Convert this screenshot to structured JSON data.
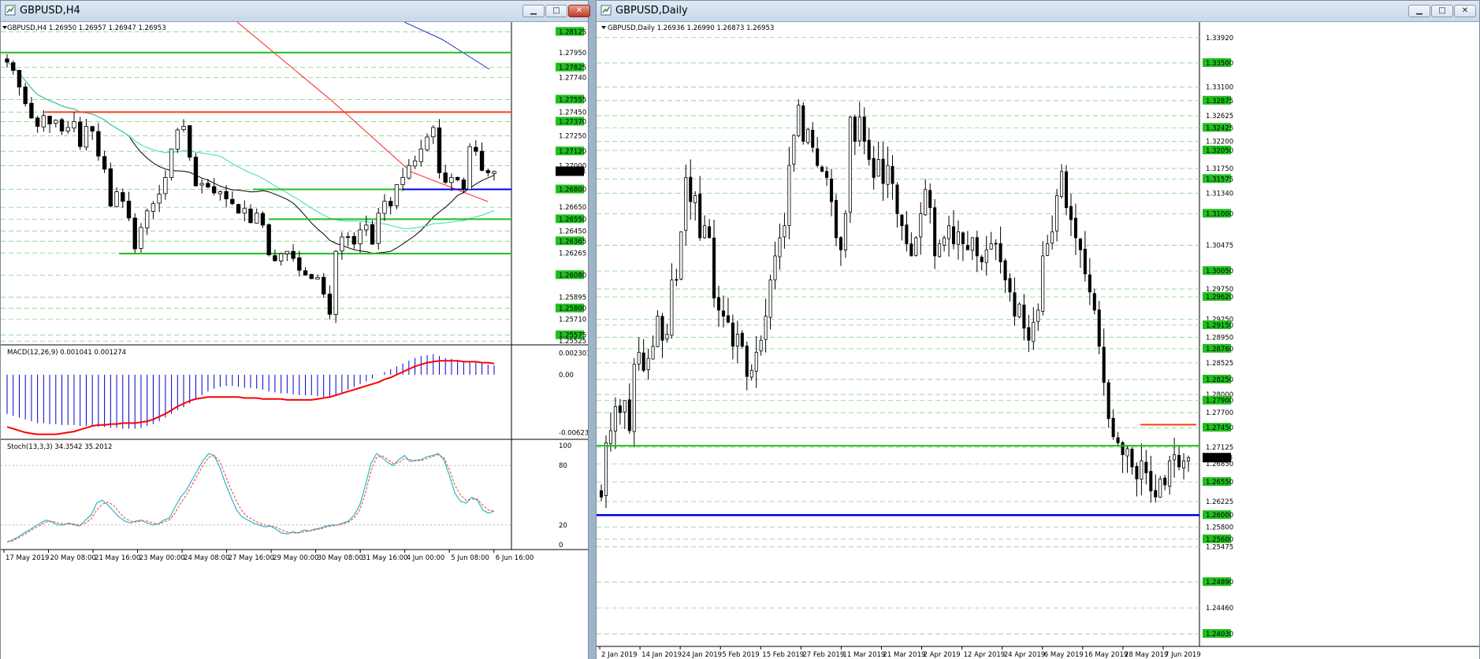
{
  "windows": {
    "left": {
      "title": "GBPUSD,H4",
      "buttons": {
        "minimize": "▁",
        "maximize": "□",
        "close": "✕"
      },
      "chart_header": "GBPUSD,H4  1.26950 1.26957 1.26947 1.26953",
      "macd_header": "MACD(12,26,9) 0.001041 0.001274",
      "stoch_header": "Stoch(13,3,3) 34.3542 35.2012"
    },
    "right": {
      "title": "GBPUSD,Daily",
      "buttons": {
        "minimize": "▁",
        "maximize": "□",
        "close": "✕"
      },
      "chart_header": "GBPUSD,Daily  1.26936 1.26990 1.26873 1.26953"
    }
  },
  "colors": {
    "green_level": "#1fbf1f",
    "dashed_level": "#7fd67f",
    "red_level": "#ff3c1a",
    "blue_level": "#0000dd",
    "price_badge": "#000000",
    "macd_hist": "#0000cc",
    "macd_signal": "#ff0000",
    "stoch_main": "#2ab7c9",
    "stoch_signal": "#ff3333",
    "ma_black": "#000000",
    "ma_red": "#ff2020",
    "ma_cyan": "#33e0b0",
    "ma_blue": "#2233cc"
  },
  "chart_data": [
    {
      "id": "h4_price",
      "type": "candlestick",
      "symbol": "GBPUSD",
      "timeframe": "H4",
      "last_price": "1.26953",
      "y_range": [
        1.2552,
        1.2818
      ],
      "y_ticks": [
        "1.28125",
        "1.27950",
        "1.27825",
        "1.27740",
        "1.27555",
        "1.27450",
        "1.27370",
        "1.27250",
        "1.27120",
        "1.27000",
        "1.26800",
        "1.26650",
        "1.26550",
        "1.26450",
        "1.26365",
        "1.26265",
        "1.26080",
        "1.25895",
        "1.25800",
        "1.25710",
        "1.25575",
        "1.25525"
      ],
      "x_labels": [
        "17 May 2019",
        "20 May 08:00",
        "21 May 16:00",
        "23 May 00:00",
        "24 May 08:00",
        "27 May 16:00",
        "29 May 00:00",
        "30 May 08:00",
        "31 May 16:00",
        "4 Jun 00:00",
        "5 Jun 08:00",
        "6 Jun 16:00"
      ],
      "green_levels": [
        1.2795,
        1.268,
        1.2655,
        1.2626
      ],
      "red_level": 1.2745,
      "blue_level": 1.268,
      "closes": [
        1.2787,
        1.278,
        1.2766,
        1.2752,
        1.274,
        1.2733,
        1.2742,
        1.2735,
        1.2738,
        1.2729,
        1.2732,
        1.2737,
        1.2716,
        1.2733,
        1.2729,
        1.2708,
        1.2697,
        1.2666,
        1.2678,
        1.267,
        1.2656,
        1.263,
        1.2648,
        1.2662,
        1.2668,
        1.2676,
        1.269,
        1.2714,
        1.273,
        1.2733,
        1.2707,
        1.2683,
        1.2685,
        1.2682,
        1.2677,
        1.2678,
        1.2672,
        1.2668,
        1.266,
        1.2664,
        1.2652,
        1.266,
        1.265,
        1.2625,
        1.262,
        1.2626,
        1.2628,
        1.2622,
        1.2612,
        1.2608,
        1.2605,
        1.2606,
        1.2592,
        1.2575,
        1.2628,
        1.264,
        1.264,
        1.2634,
        1.2646,
        1.265,
        1.2634,
        1.266,
        1.267,
        1.2666,
        1.2684,
        1.269,
        1.27,
        1.2704,
        1.2714,
        1.2724,
        1.2732,
        1.2694,
        1.2686,
        1.269,
        1.2688,
        1.268,
        1.2716,
        1.2712,
        1.2696,
        1.2694,
        1.2695
      ]
    },
    {
      "id": "h4_macd",
      "type": "histogram+line",
      "name": "MACD(12,26,9)",
      "y_ticks": [
        "0.002301",
        "0.00",
        "-0.006231"
      ],
      "y_range": [
        -0.0066,
        0.0027
      ],
      "histogram": [
        -0.0042,
        -0.0044,
        -0.0046,
        -0.0048,
        -0.005,
        -0.0052,
        -0.0052,
        -0.0053,
        -0.0053,
        -0.0054,
        -0.0054,
        -0.0054,
        -0.0055,
        -0.0055,
        -0.0055,
        -0.0056,
        -0.0056,
        -0.0057,
        -0.0057,
        -0.0058,
        -0.0058,
        -0.0058,
        -0.0057,
        -0.0055,
        -0.0053,
        -0.005,
        -0.0046,
        -0.0042,
        -0.0038,
        -0.0035,
        -0.0031,
        -0.0026,
        -0.0022,
        -0.0018,
        -0.0015,
        -0.0013,
        -0.0012,
        -0.0012,
        -0.0013,
        -0.0014,
        -0.0014,
        -0.0015,
        -0.0016,
        -0.0018,
        -0.0019,
        -0.002,
        -0.002,
        -0.0021,
        -0.0022,
        -0.0022,
        -0.0022,
        -0.0023,
        -0.0024,
        -0.0025,
        -0.0022,
        -0.0019,
        -0.0016,
        -0.0013,
        -0.001,
        -0.0007,
        -0.0004,
        0.0,
        0.0003,
        0.0006,
        0.0009,
        0.0012,
        0.0015,
        0.0018,
        0.002,
        0.0021,
        0.0022,
        0.002,
        0.0018,
        0.0017,
        0.0016,
        0.0014,
        0.0014,
        0.0014,
        0.0013,
        0.0011,
        0.001
      ],
      "signal": [
        -0.0056,
        -0.0058,
        -0.006,
        -0.0062,
        -0.0063,
        -0.0064,
        -0.0064,
        -0.0064,
        -0.0064,
        -0.0063,
        -0.0062,
        -0.0061,
        -0.0059,
        -0.0057,
        -0.0055,
        -0.0054,
        -0.0054,
        -0.0053,
        -0.0053,
        -0.0052,
        -0.0052,
        -0.0052,
        -0.0051,
        -0.005,
        -0.0048,
        -0.0045,
        -0.0042,
        -0.0038,
        -0.0034,
        -0.0031,
        -0.0028,
        -0.0026,
        -0.0025,
        -0.0024,
        -0.0024,
        -0.0024,
        -0.0024,
        -0.0024,
        -0.0024,
        -0.0025,
        -0.0025,
        -0.0025,
        -0.0026,
        -0.0026,
        -0.0026,
        -0.0026,
        -0.0027,
        -0.0027,
        -0.0027,
        -0.0027,
        -0.0027,
        -0.0026,
        -0.0025,
        -0.0024,
        -0.0022,
        -0.002,
        -0.0018,
        -0.0016,
        -0.0014,
        -0.0012,
        -0.001,
        -0.0008,
        -0.0005,
        -0.0003,
        0.0,
        0.0003,
        0.0006,
        0.0009,
        0.0011,
        0.0013,
        0.0014,
        0.0015,
        0.0015,
        0.0015,
        0.0015,
        0.0014,
        0.0014,
        0.0014,
        0.0013,
        0.0013,
        0.0012
      ]
    },
    {
      "id": "h4_stoch",
      "type": "line",
      "name": "Stoch(13,3,3)",
      "y_ticks": [
        "100",
        "80",
        "20",
        "0"
      ],
      "y_range": [
        0,
        100
      ],
      "main": [
        3,
        5,
        8,
        12,
        15,
        19,
        22,
        25,
        23,
        20,
        20,
        22,
        20,
        19,
        25,
        30,
        42,
        45,
        40,
        34,
        28,
        24,
        22,
        24,
        25,
        22,
        20,
        21,
        25,
        27,
        38,
        48,
        55,
        65,
        75,
        85,
        92,
        90,
        78,
        62,
        48,
        35,
        28,
        25,
        22,
        20,
        18,
        19,
        16,
        12,
        11,
        13,
        12,
        15,
        14,
        16,
        17,
        19,
        20,
        20,
        22,
        24,
        30,
        40,
        60,
        82,
        92,
        88,
        83,
        80,
        86,
        90,
        84,
        85,
        86,
        89,
        90,
        92,
        86,
        70,
        52,
        44,
        42,
        48,
        45,
        35,
        32,
        34
      ],
      "signal": [
        3,
        4,
        7,
        10,
        14,
        17,
        20,
        23,
        24,
        22,
        21,
        21,
        21,
        20,
        22,
        26,
        35,
        41,
        43,
        40,
        33,
        27,
        24,
        23,
        24,
        24,
        22,
        21,
        23,
        25,
        32,
        42,
        50,
        60,
        70,
        80,
        88,
        90,
        84,
        70,
        56,
        44,
        34,
        28,
        25,
        22,
        20,
        19,
        18,
        15,
        13,
        12,
        12,
        13,
        14,
        15,
        16,
        18,
        19,
        20,
        21,
        23,
        27,
        35,
        52,
        74,
        88,
        90,
        86,
        82,
        83,
        87,
        86,
        85,
        85,
        87,
        89,
        91,
        88,
        76,
        60,
        50,
        45,
        46,
        46,
        40,
        35,
        34
      ]
    },
    {
      "id": "daily_price",
      "type": "candlestick",
      "symbol": "GBPUSD",
      "timeframe": "Daily",
      "last_price": "1.26953",
      "y_range": [
        1.239,
        1.341
      ],
      "y_ticks": [
        "1.33920",
        "1.33500",
        "1.33100",
        "1.32875",
        "1.32625",
        "1.32425",
        "1.32200",
        "1.32050",
        "1.31750",
        "1.31575",
        "1.31340",
        "1.31000",
        "1.30475",
        "1.30050",
        "1.29750",
        "1.29620",
        "1.29250",
        "1.29150",
        "1.28950",
        "1.28760",
        "1.28525",
        "1.28250",
        "1.28000",
        "1.27900",
        "1.27700",
        "1.27450",
        "1.27125",
        "1.26953",
        "1.26850",
        "1.26550",
        "1.26225",
        "1.26000",
        "1.25800",
        "1.25600",
        "1.25475",
        "1.24890",
        "1.24460",
        "1.24030"
      ],
      "x_labels": [
        "2 Jan 2019",
        "14 Jan 2019",
        "24 Jan 2019",
        "5 Feb 2019",
        "15 Feb 2019",
        "27 Feb 2019",
        "11 Mar 2019",
        "21 Mar 2019",
        "2 Apr 2019",
        "12 Apr 2019",
        "24 Apr 2019",
        "6 May 2019",
        "16 May 2019",
        "28 May 2019",
        "7 Jun 2019"
      ],
      "green_level": 1.2715,
      "red_level": 1.275,
      "blue_level": 1.26,
      "closes": [
        1.263,
        1.272,
        1.274,
        1.278,
        1.277,
        1.279,
        1.274,
        1.285,
        1.287,
        1.284,
        1.286,
        1.288,
        1.293,
        1.289,
        1.29,
        1.299,
        1.299,
        1.307,
        1.316,
        1.312,
        1.313,
        1.306,
        1.308,
        1.306,
        1.296,
        1.294,
        1.293,
        1.292,
        1.288,
        1.29,
        1.288,
        1.283,
        1.284,
        1.287,
        1.289,
        1.293,
        1.299,
        1.303,
        1.306,
        1.308,
        1.318,
        1.323,
        1.328,
        1.322,
        1.324,
        1.321,
        1.318,
        1.317,
        1.316,
        1.312,
        1.306,
        1.304,
        1.31,
        1.326,
        1.322,
        1.326,
        1.322,
        1.319,
        1.316,
        1.319,
        1.315,
        1.318,
        1.315,
        1.31,
        1.308,
        1.305,
        1.303,
        1.306,
        1.31,
        1.314,
        1.311,
        1.303,
        1.305,
        1.306,
        1.308,
        1.305,
        1.307,
        1.305,
        1.304,
        1.306,
        1.303,
        1.302,
        1.304,
        1.305,
        1.305,
        1.302,
        1.299,
        1.297,
        1.293,
        1.295,
        1.291,
        1.289,
        1.292,
        1.294,
        1.303,
        1.305,
        1.307,
        1.313,
        1.317,
        1.311,
        1.309,
        1.306,
        1.304,
        1.3,
        1.297,
        1.294,
        1.288,
        1.282,
        1.276,
        1.273,
        1.272,
        1.27,
        1.271,
        1.268,
        1.266,
        1.269,
        1.267,
        1.264,
        1.263,
        1.266,
        1.265,
        1.269,
        1.27,
        1.268,
        1.269,
        1.2695
      ]
    }
  ]
}
